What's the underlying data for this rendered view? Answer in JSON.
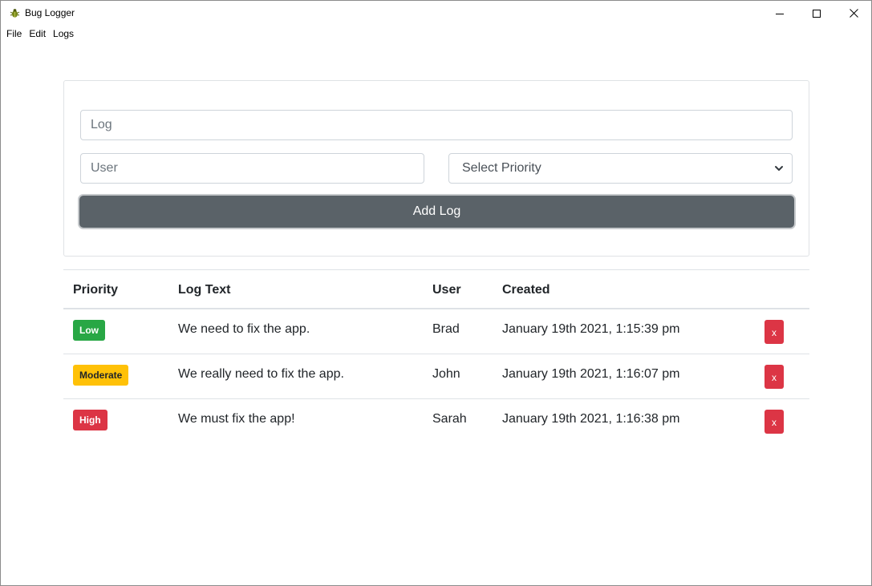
{
  "window": {
    "title": "Bug Logger",
    "icon": "bug-icon"
  },
  "menu": [
    "File",
    "Edit",
    "Logs"
  ],
  "form": {
    "log_placeholder": "Log",
    "user_placeholder": "User",
    "priority_selected": "Select Priority",
    "add_label": "Add Log"
  },
  "table": {
    "headers": [
      "Priority",
      "Log Text",
      "User",
      "Created"
    ],
    "rows": [
      {
        "priority": "Low",
        "text": "We need to fix the app.",
        "user": "Brad",
        "created": "January 19th 2021, 1:15:39 pm",
        "delete": "x"
      },
      {
        "priority": "Moderate",
        "text": "We really need to fix the app.",
        "user": "John",
        "created": "January 19th 2021, 1:16:07 pm",
        "delete": "x"
      },
      {
        "priority": "High",
        "text": "We must fix the app!",
        "user": "Sarah",
        "created": "January 19th 2021, 1:16:38 pm",
        "delete": "x"
      }
    ]
  },
  "colors": {
    "low": "#28a745",
    "moderate": "#ffc107",
    "high": "#dc3545",
    "button_secondary": "#5a6268",
    "delete": "#dc3545"
  }
}
